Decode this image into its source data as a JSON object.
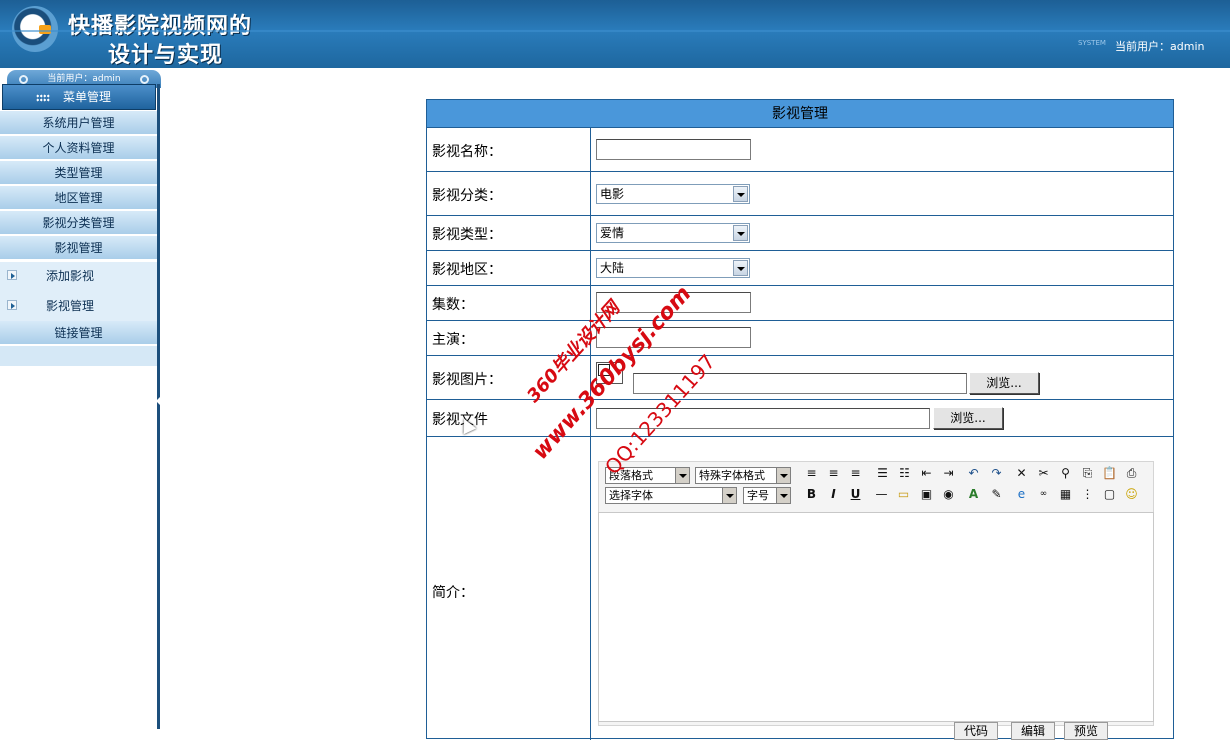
{
  "header": {
    "title_line1": "快播影院视频网的",
    "title_line2": "设计与实现",
    "system_tag": "SYSTEM",
    "current_user": "当前用户：admin"
  },
  "sidebar": {
    "user_bar": "当前用户：admin",
    "menu_head": "菜单管理",
    "items": [
      {
        "label": "系统用户管理"
      },
      {
        "label": "个人资料管理"
      },
      {
        "label": "类型管理"
      },
      {
        "label": "地区管理"
      },
      {
        "label": "影视分类管理"
      },
      {
        "label": "影视管理"
      }
    ],
    "sub_items": [
      {
        "label": "添加影视"
      },
      {
        "label": "影视管理"
      }
    ],
    "last_item": {
      "label": "链接管理"
    }
  },
  "form": {
    "title": "影视管理",
    "fields": {
      "name": {
        "label": "影视名称：",
        "value": ""
      },
      "category": {
        "label": "影视分类：",
        "value": "电影"
      },
      "genre": {
        "label": "影视类型：",
        "value": "爱情"
      },
      "region": {
        "label": "影视地区：",
        "value": "大陆"
      },
      "episodes": {
        "label": "集数：",
        "value": ""
      },
      "actors": {
        "label": "主演：",
        "value": ""
      },
      "picture": {
        "label": "影视图片：",
        "browse": "浏览..."
      },
      "file": {
        "label": "影视文件",
        "browse": "浏览..."
      },
      "intro": {
        "label": "简介："
      }
    },
    "editor": {
      "paragraph_format": "段落格式",
      "special_format": "特殊字体格式",
      "font_select": "选择字体",
      "font_size": "字号",
      "tabs": [
        "代码",
        "编辑",
        "预览"
      ]
    }
  },
  "watermark": {
    "line1": "360毕业设计网",
    "line2": "www.360bysj.com",
    "line3": "QQ:123311197"
  },
  "colors": {
    "header_blue": "#2a7cbb",
    "form_head": "#4a97da",
    "border": "#1f5e96",
    "watermark_red": "#d70a12"
  }
}
